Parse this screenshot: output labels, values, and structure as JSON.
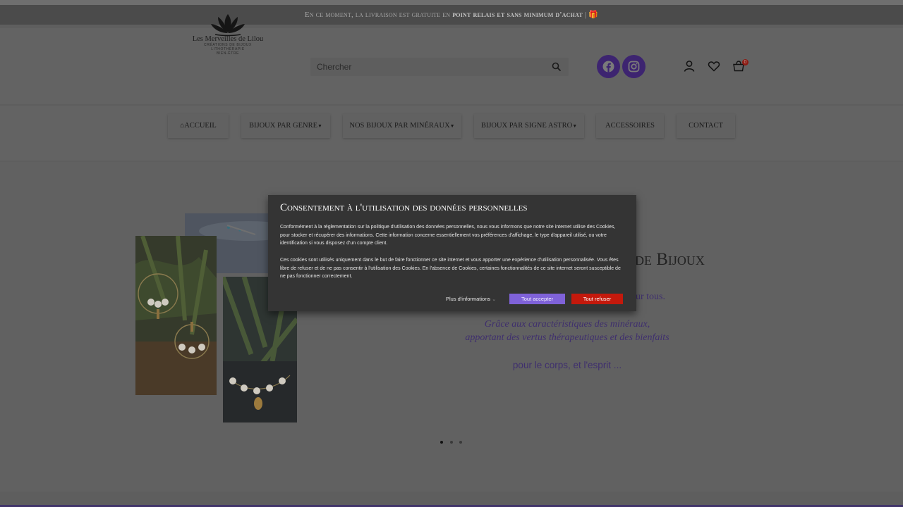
{
  "announcement": {
    "text_before": "En ce moment, la livraison est gratuite en ",
    "highlight": "point relais et sans minimum d'achat",
    "text_after": " | ",
    "gift_glyph": "🎁"
  },
  "logo": {
    "name": "Les Merveilles de Lilou",
    "line2": "CRÉATIONS DE BIJOUX",
    "line3": "LITHOTHÉRAPIE",
    "line4": "BIEN-ÊTRE"
  },
  "search": {
    "placeholder": "Chercher",
    "value": "",
    "icon": "search-icon"
  },
  "social": [
    {
      "name": "facebook",
      "icon": "facebook-icon",
      "color": "#3d2470"
    },
    {
      "name": "instagram",
      "icon": "instagram-icon",
      "color": "#3d2470"
    }
  ],
  "header_icons": {
    "account": "user-icon",
    "wishlist": "heart-icon",
    "cart": "cart-icon",
    "cart_count": "0"
  },
  "nav": {
    "items": [
      {
        "label": "ACCUEIL",
        "has_dropdown": false
      },
      {
        "label": "BIJOUX PAR GENRE",
        "has_dropdown": true
      },
      {
        "label": "NOS BIJOUX PAR MINÉRAUX",
        "has_dropdown": true
      },
      {
        "label": "BIJOUX PAR SIGNE ASTRO",
        "has_dropdown": true
      },
      {
        "label": "ACCESSOIRES",
        "has_dropdown": false
      },
      {
        "label": "CONTACT",
        "has_dropdown": false
      }
    ]
  },
  "hero": {
    "title_partial": "de Bijoux",
    "subtitle_partial": "our tous.",
    "line1": "Grâce aux caractéristiques des minéraux,",
    "line2": "apportant des vertus thérapeutiques et des bienfaits",
    "line3": "pour le corps, et l'esprit ...",
    "slides": 3,
    "active_slide": 1
  },
  "cookie_modal": {
    "title": "Consentement à l'utilisation des données personnelles",
    "paragraph1": "Conformément à la réglementation sur la politique d'utilisation des données personnelles, nous vous informons que notre site internet utilise des Cookies, pour stocker et récupérer des informations. Cette information concerne essentiellement vos préférences d'affichage, le type d'appareil utilisé, ou votre identification si vous disposez d'un compte client.",
    "paragraph2": "Ces cookies sont utilisés uniquement dans le but de faire fonctionner ce site internet et vous apporter une expérience d'utilisation personnalisée. Vous êtes libre de refuser et de ne pas consentir à l'utilisation des Cookies. En l'absence de Cookies, certaines fonctionnalités de ce site internet seront susceptible de ne pas fonctionner correctement.",
    "more_info": "Plus d'informations",
    "accept": "Tout accepter",
    "refuse": "Tout refuser",
    "accept_color": "#7f62d9",
    "refuse_color": "#c4190c"
  }
}
